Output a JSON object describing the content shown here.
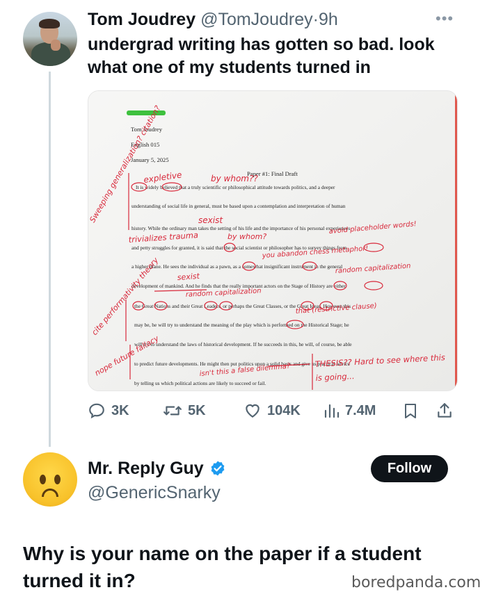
{
  "tweet": {
    "author_name": "Tom Joudrey",
    "author_handle": "@TomJoudrey",
    "separator": "·",
    "time": "9h",
    "text": "undergrad writing has gotten so bad. look what one of my students turned in",
    "more_icon": "more-icon"
  },
  "paper": {
    "header_lines": [
      "Tom Joudrey",
      "English 015",
      "January 5, 2025"
    ],
    "title": "Paper #1: Final Draft",
    "body_lines": [
      "It is widely believed that a truly scientific or philosophical attitude towards politics, and a deeper",
      "understanding of social life in general, must be based upon a contemplation and interpretation of human",
      "history. While the ordinary man takes the setting of his life and the importance of his personal experiences",
      "and petty struggles for granted, it is said that the social scientist or philosopher has to survey things from",
      "a higher plane. He sees the individual as a pawn, as a somewhat insignificant instrument in the general",
      "development of mankind. And he finds that the really important actors on the Stage of History are either",
      "the Great Nations and their Great Leaders, or perhaps the Great Classes, or the Great Ideas. However this",
      "may be, he will try to understand the meaning of the play which is performed on the Historical Stage; he",
      "will try to understand the laws of historical development. If he succeeds in this, he will, of course, be able",
      "to predict future developments. He might then put politics upon a solid basis and give us practical advice",
      "by telling us which political actions are likely to succeed or fail."
    ],
    "annotations": {
      "sweeping": "Sweeping generalization? citation?",
      "expletive": "expletive",
      "by_whom_1": "by whom??",
      "sexist_1": "sexist",
      "trivializes": "trivializes trauma",
      "by_whom_2": "by whom?",
      "placeholder": "avoid placeholder words!",
      "chess": "you abandon chess metaphor!",
      "random_cap_1": "random capitalization",
      "sexist_2": "sexist",
      "random_cap_2": "random capitalization",
      "cite_theory": "cite performativity theory",
      "restrictive": "that (restrictive clause)",
      "nope": "nope future fallacy",
      "false_dilemma": "isn't this a false dilemma?",
      "thesis": "THESIS?? Hard to see where this is going..."
    }
  },
  "actions": {
    "replies": "3K",
    "retweets": "5K",
    "likes": "104K",
    "views": "7.4M"
  },
  "reply": {
    "name": "Mr. Reply Guy",
    "handle": "@GenericSnarky",
    "follow_label": "Follow",
    "text": "Why is your name on the paper if a student turned it in?"
  },
  "watermark": "boredpanda.com",
  "colors": {
    "verified": "#1d9bf0",
    "ink_red": "#d8283a",
    "text_primary": "#0f1419",
    "text_secondary": "#536471"
  }
}
